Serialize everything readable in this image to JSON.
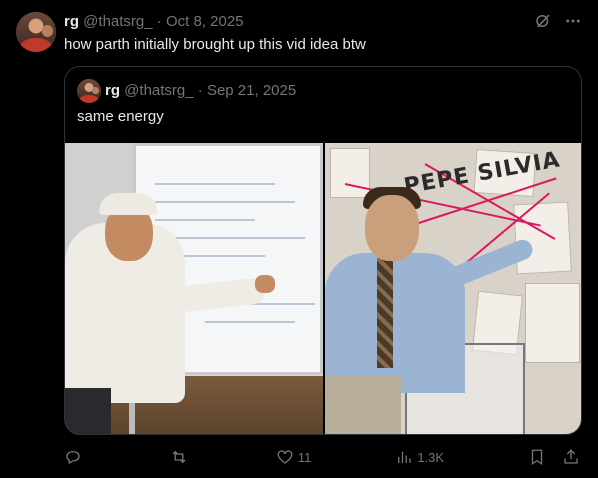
{
  "tweet": {
    "author_name": "rg",
    "handle": "@thatsrg_",
    "separator": "·",
    "date": "Oct 8, 2025",
    "text": "how parth initially brought up this vid idea btw",
    "top_icons": [
      "grok-icon",
      "more-icon"
    ]
  },
  "quoted_tweet": {
    "author_name": "rg",
    "handle": "@thatsrg_",
    "separator": "·",
    "date": "Sep 21, 2025",
    "text": "same energy",
    "images": [
      {
        "kind": "photo",
        "description_icon": "photo-image"
      },
      {
        "kind": "photo",
        "board_text": "PEPE SILVIA"
      }
    ]
  },
  "actions": {
    "reply": {
      "icon": "reply-icon",
      "count": ""
    },
    "repost": {
      "icon": "repost-icon",
      "count": ""
    },
    "like": {
      "icon": "heart-icon",
      "count": "11"
    },
    "views": {
      "icon": "views-icon",
      "count": "1.3K"
    },
    "bookmark": {
      "icon": "bookmark-icon"
    },
    "share": {
      "icon": "share-icon"
    }
  },
  "colors": {
    "background": "#000000",
    "text": "#e7e9ea",
    "muted": "#71767b",
    "border": "#2f3336"
  }
}
